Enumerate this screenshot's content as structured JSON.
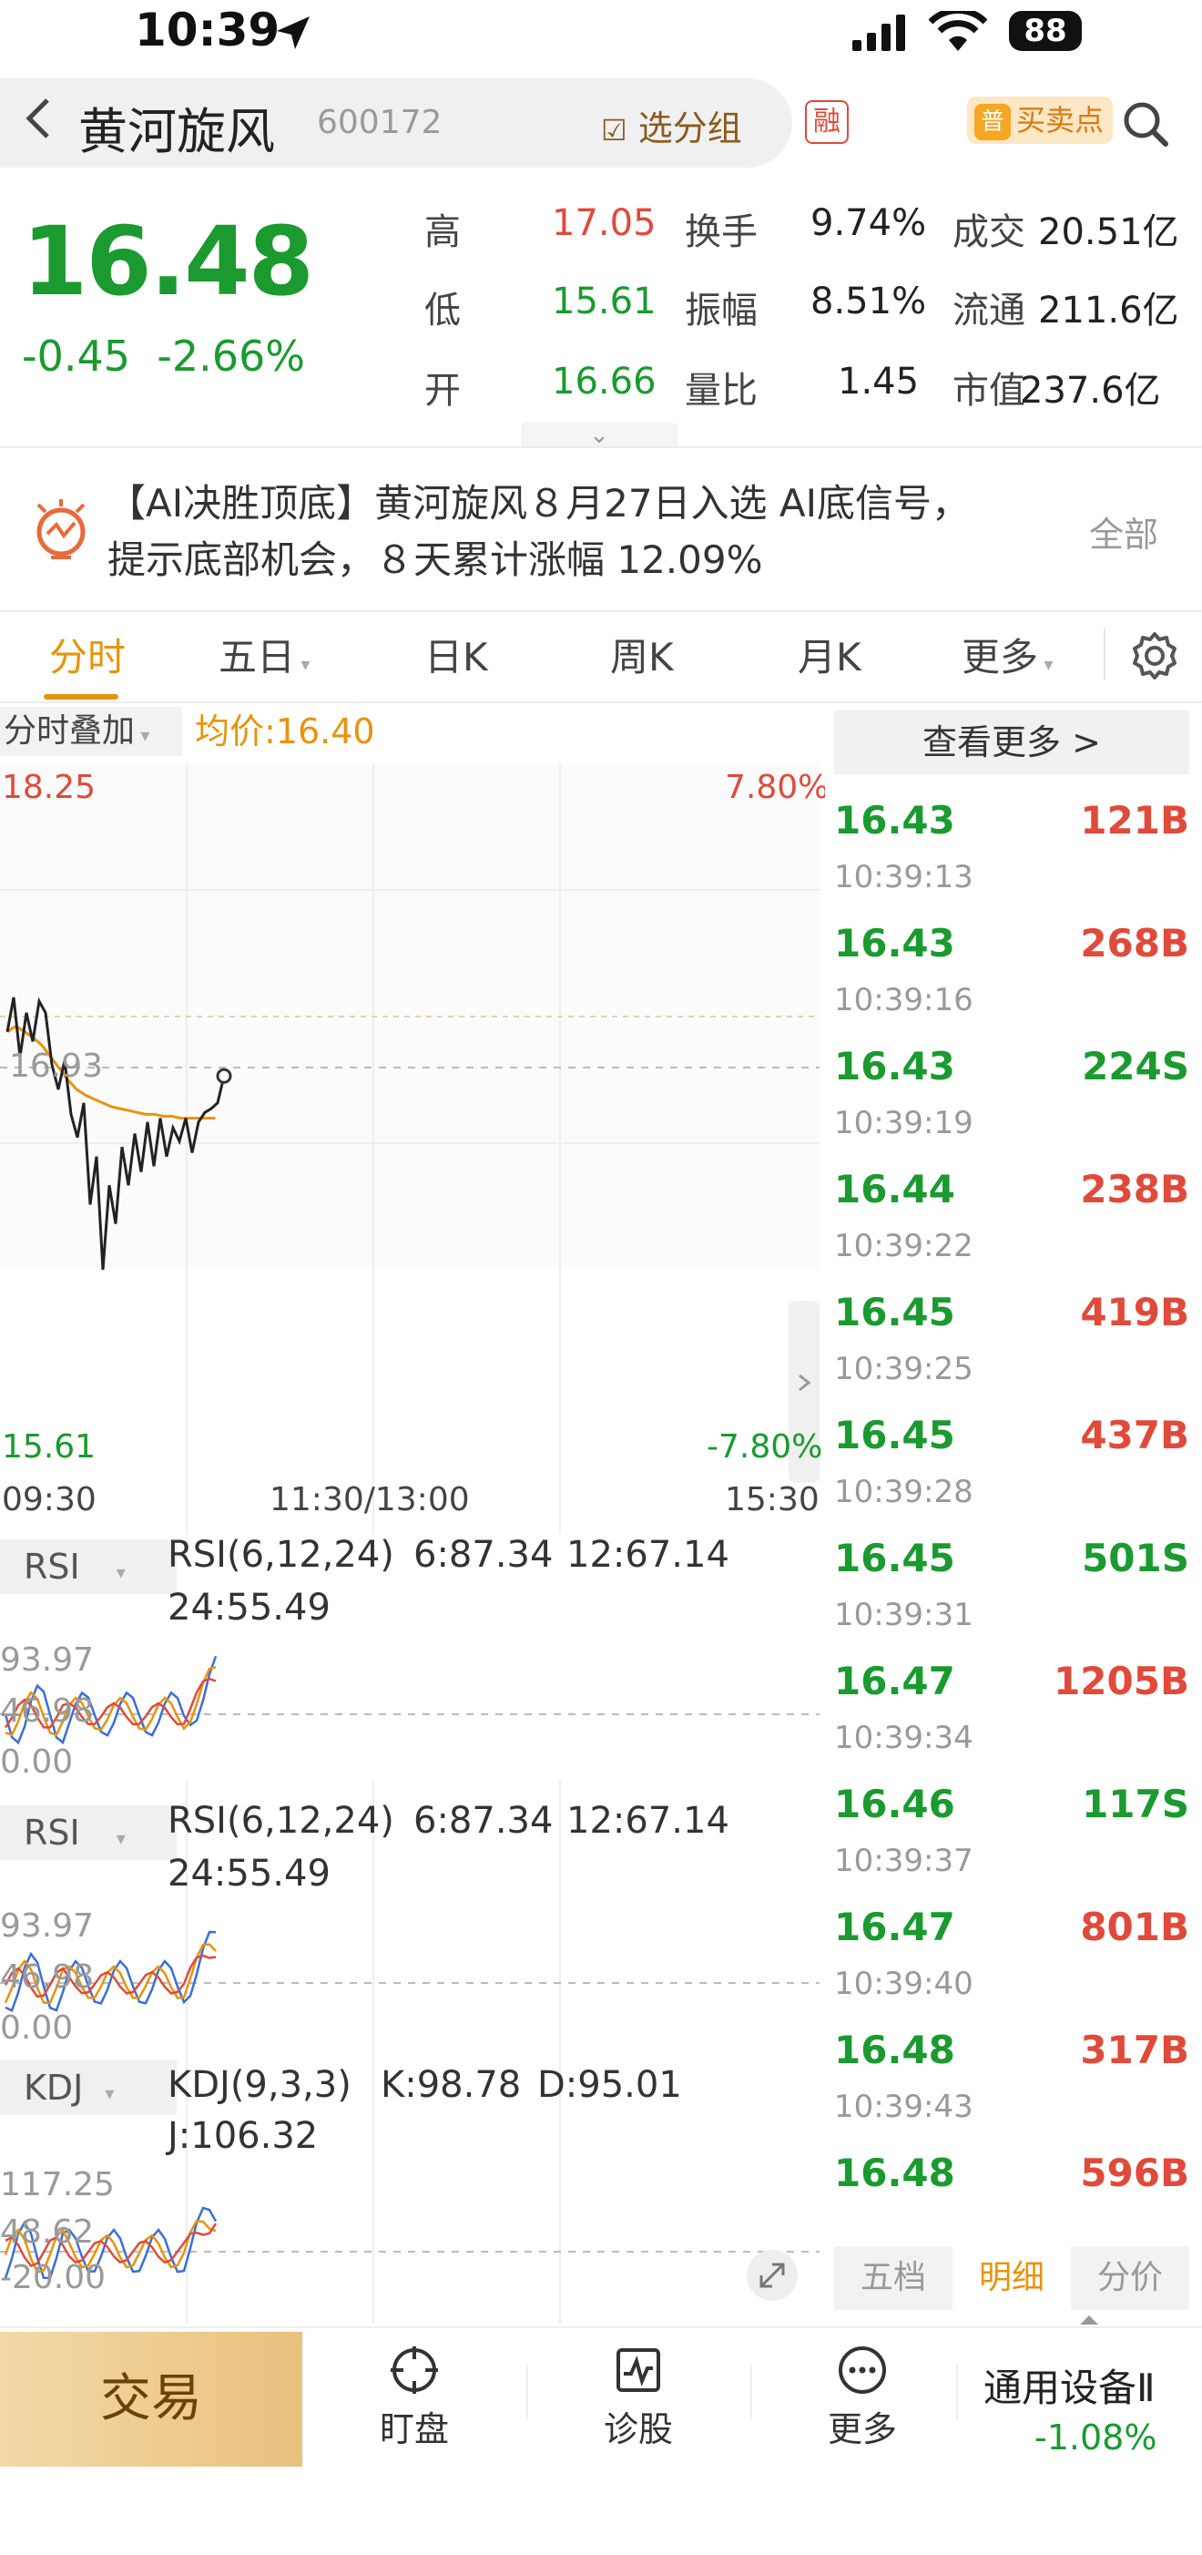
{
  "status_bar": {
    "time": "10:39",
    "battery": "88"
  },
  "header": {
    "stock_name": "黄河旋风",
    "stock_code": "600172",
    "group_button": "选分组",
    "margin_badge": "融",
    "buy_sell_badge": "普",
    "buy_sell_label": "买卖点"
  },
  "quote": {
    "price": "16.48",
    "change": "-0.45",
    "change_pct": "-2.66%",
    "rows": [
      {
        "l1": "高",
        "v1": "17.05",
        "l2": "换手",
        "v2": "9.74%",
        "l3": "成交",
        "v3": "20.51亿"
      },
      {
        "l1": "低",
        "v1": "15.61",
        "l2": "振幅",
        "v2": "8.51%",
        "l3": "流通",
        "v3": "211.6亿"
      },
      {
        "l1": "开",
        "v1": "16.66",
        "l2": "量比",
        "v2": "1.45",
        "l3": "市值",
        "v3": "237.6亿"
      }
    ]
  },
  "ai_banner": {
    "line1": "【AI决胜顶底】黄河旋风８月27日入选 AI底信号，",
    "line2": "提示底部机会，８天累计涨幅 12.09%",
    "all_label": "全部"
  },
  "tabs": [
    "分时",
    "五日",
    "日K",
    "周K",
    "月K",
    "更多"
  ],
  "chart": {
    "overlay_label": "分时叠加",
    "avg_label": "均价:16.40",
    "y_top": "18.25",
    "y_top_pct": "7.80%",
    "y_ref": "16.93",
    "y_bottom": "15.61",
    "y_bottom_pct": "-7.80%",
    "x_start": "09:30",
    "x_mid": "11:30/13:00",
    "x_end": "15:30",
    "price_series": [
      16.85,
      17.03,
      16.72,
      16.95,
      16.8,
      17.01,
      16.95,
      16.68,
      16.55,
      16.7,
      16.42,
      16.3,
      16.48,
      15.95,
      16.2,
      15.61,
      16.05,
      15.85,
      16.25,
      16.05,
      16.32,
      16.12,
      16.38,
      16.15,
      16.4,
      16.2,
      16.35,
      16.28,
      16.4,
      16.22,
      16.38,
      16.43,
      16.45,
      16.48,
      16.62
    ],
    "avg_series": [
      16.85,
      16.88,
      16.85,
      16.82,
      16.78,
      16.72,
      16.66,
      16.6,
      16.55,
      16.52,
      16.5,
      16.48,
      16.46,
      16.45,
      16.44,
      16.43,
      16.42,
      16.42,
      16.41,
      16.41,
      16.4,
      16.4,
      16.4,
      16.4,
      16.4
    ]
  },
  "indicators": [
    {
      "button": "RSI",
      "name": "RSI(6,12,24)",
      "v1": "6:87.34",
      "v2": "12:67.14",
      "v3": "24:55.49",
      "top": "93.97",
      "mid": "46.98",
      "bottom": "0.00"
    },
    {
      "button": "RSI",
      "name": "RSI(6,12,24)",
      "v1": "6:87.34",
      "v2": "12:67.14",
      "v3": "24:55.49",
      "top": "93.97",
      "mid": "46.98",
      "bottom": "0.00"
    },
    {
      "button": "KDJ",
      "name": "KDJ(9,3,3)",
      "v1": "K:98.78",
      "v2": "D:95.01",
      "v3": "J:106.32",
      "top": "117.25",
      "mid": "48.62",
      "bottom": "-20.00"
    }
  ],
  "right_panel": {
    "more_label": "查看更多 >",
    "trades": [
      {
        "time": "",
        "price": "16.43",
        "vol": "121B",
        "side": "B"
      },
      {
        "time": "10:39:13",
        "price": "16.43",
        "vol": "268B",
        "side": "B"
      },
      {
        "time": "10:39:16",
        "price": "16.43",
        "vol": "224S",
        "side": "S"
      },
      {
        "time": "10:39:19",
        "price": "16.44",
        "vol": "238B",
        "side": "B"
      },
      {
        "time": "10:39:22",
        "price": "16.45",
        "vol": "419B",
        "side": "B"
      },
      {
        "time": "10:39:25",
        "price": "16.45",
        "vol": "437B",
        "side": "B"
      },
      {
        "time": "10:39:28",
        "price": "16.45",
        "vol": "501S",
        "side": "S"
      },
      {
        "time": "10:39:31",
        "price": "16.47",
        "vol": "1205B",
        "side": "B"
      },
      {
        "time": "10:39:34",
        "price": "16.46",
        "vol": "117S",
        "side": "S"
      },
      {
        "time": "10:39:37",
        "price": "16.47",
        "vol": "801B",
        "side": "B"
      },
      {
        "time": "10:39:40",
        "price": "16.48",
        "vol": "317B",
        "side": "B"
      },
      {
        "time": "10:39:43",
        "price": "16.48",
        "vol": "596B",
        "side": "B"
      }
    ],
    "tabs": [
      "五档",
      "明细",
      "分价"
    ]
  },
  "bottom_bar": {
    "trade": "交易",
    "items": [
      {
        "label": "盯盘",
        "icon": "crosshair-icon"
      },
      {
        "label": "诊股",
        "icon": "pulse-chart-icon"
      },
      {
        "label": "更多",
        "icon": "more-dots-icon"
      }
    ],
    "industry": "通用设备Ⅱ",
    "industry_change": "-1.08%"
  },
  "colors": {
    "up": "#e04a3a",
    "down": "#1a9a2f",
    "accent": "#e8930c",
    "blue": "#3a6fd8"
  }
}
